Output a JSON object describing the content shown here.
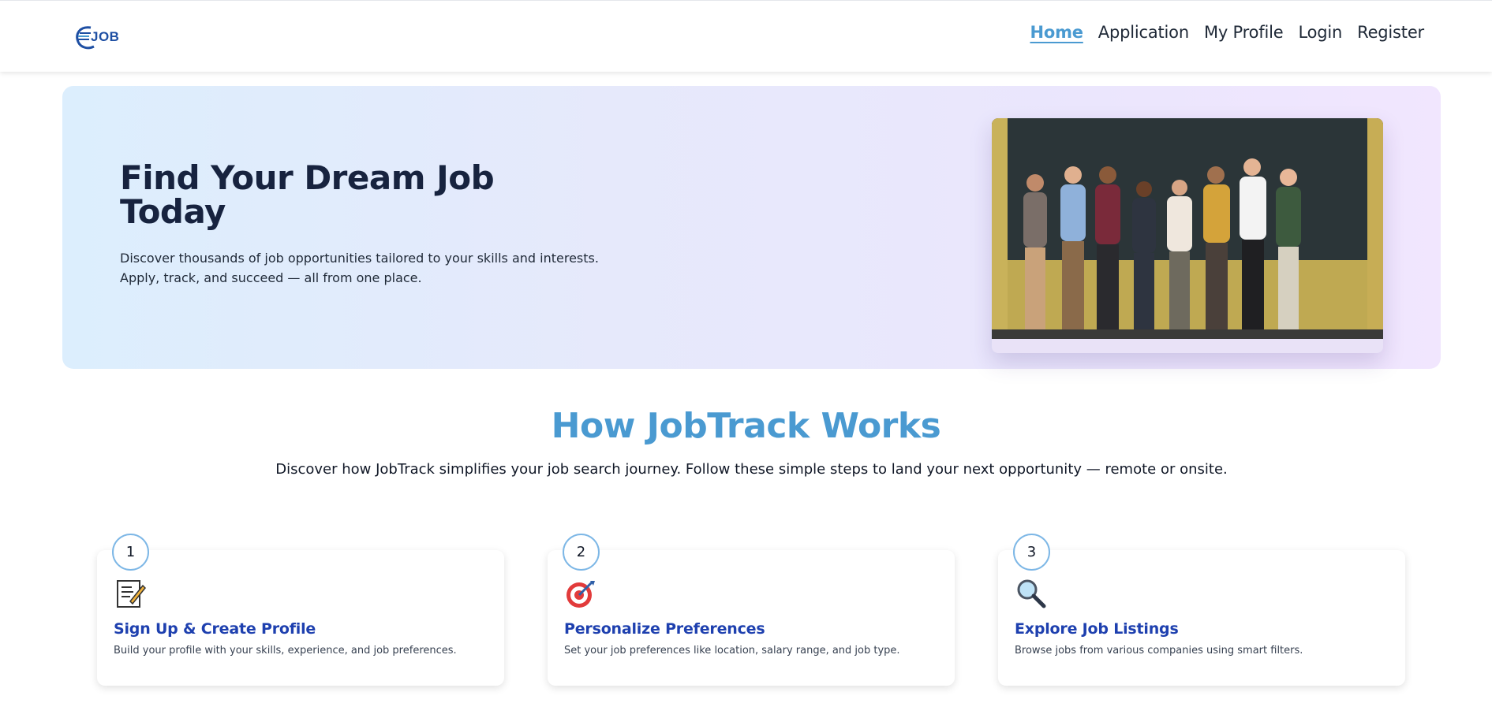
{
  "app": {
    "logo_text": "JOB"
  },
  "nav": {
    "items": [
      {
        "label": "Home",
        "active": true
      },
      {
        "label": "Application",
        "active": false
      },
      {
        "label": "My Profile",
        "active": false
      },
      {
        "label": "Login",
        "active": false
      },
      {
        "label": "Register",
        "active": false
      }
    ]
  },
  "hero": {
    "title": "Find Your Dream Job Today",
    "subtitle_line1": "Discover thousands of job opportunities tailored to your skills and interests.",
    "subtitle_line2": "Apply, track, and succeed — all from one place.",
    "image": "team-celebrating-photo"
  },
  "how": {
    "title": "How JobTrack Works",
    "subtitle": "Discover how JobTrack simplifies your job search journey. Follow these simple steps to land your next opportunity — remote or onsite."
  },
  "steps": [
    {
      "number": "1",
      "icon": "memo-icon",
      "title": "Sign Up & Create Profile",
      "description": "Build your profile with your skills, experience, and job preferences."
    },
    {
      "number": "2",
      "icon": "target-icon",
      "title": "Personalize Preferences",
      "description": "Set your job preferences like location, salary range, and job type."
    },
    {
      "number": "3",
      "icon": "magnifier-icon",
      "title": "Explore Job Listings",
      "description": "Browse jobs from various companies using smart filters."
    }
  ],
  "colors": {
    "accent": "#4a9ad1",
    "step_title": "#1e40af",
    "heading_dark": "#17233f"
  }
}
